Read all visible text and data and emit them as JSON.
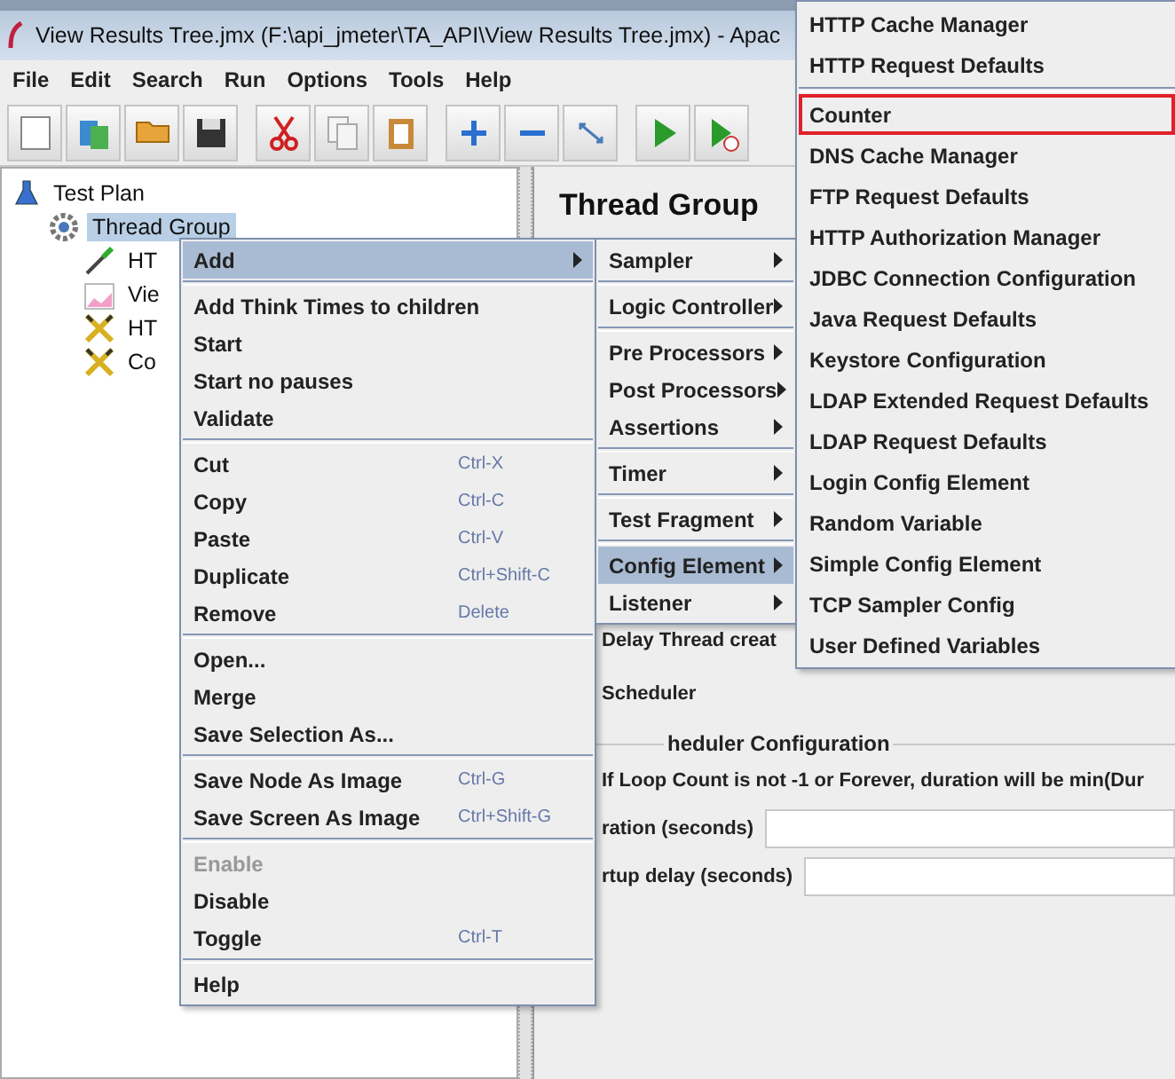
{
  "title_bar": {
    "title": "View Results Tree.jmx (F:\\api_jmeter\\TA_API\\View Results Tree.jmx) - Apac"
  },
  "menu_bar": [
    "File",
    "Edit",
    "Search",
    "Run",
    "Options",
    "Tools",
    "Help"
  ],
  "tree": [
    {
      "label": "Test Plan",
      "kind": "plan",
      "selected": false,
      "children": [
        {
          "label": "Thread Group",
          "kind": "threads",
          "selected": true,
          "children": [
            {
              "label": "HT",
              "kind": "sampler",
              "selected": false
            },
            {
              "label": "Vie",
              "kind": "listener",
              "selected": false
            },
            {
              "label": "HT",
              "kind": "config",
              "selected": false
            },
            {
              "label": "Co",
              "kind": "config",
              "selected": false
            }
          ]
        }
      ]
    }
  ],
  "thread_group_panel": {
    "title": "Thread Group",
    "delay_option": "Delay Thread creat",
    "scheduler_option": "Scheduler",
    "scheduler_section": "heduler Configuration",
    "scheduler_note": "If Loop Count is not -1 or Forever, duration will be min(Dur",
    "fields": [
      {
        "label": "ration (seconds)"
      },
      {
        "label": "rtup delay (seconds)"
      }
    ]
  },
  "context_menu": [
    [
      {
        "label": "Add",
        "submenu": true,
        "selected": true,
        "disabled": false
      }
    ],
    [
      {
        "label": "Add Think Times to children",
        "submenu": false,
        "selected": false,
        "disabled": false
      },
      {
        "label": "Start",
        "submenu": false,
        "selected": false,
        "disabled": false
      },
      {
        "label": "Start no pauses",
        "submenu": false,
        "selected": false,
        "disabled": false
      },
      {
        "label": "Validate",
        "submenu": false,
        "selected": false,
        "disabled": false
      }
    ],
    [
      {
        "label": "Cut",
        "shortcut": "Ctrl-X",
        "submenu": false,
        "selected": false,
        "disabled": false
      },
      {
        "label": "Copy",
        "shortcut": "Ctrl-C",
        "submenu": false,
        "selected": false,
        "disabled": false
      },
      {
        "label": "Paste",
        "shortcut": "Ctrl-V",
        "submenu": false,
        "selected": false,
        "disabled": false
      },
      {
        "label": "Duplicate",
        "shortcut": "Ctrl+Shift-C",
        "submenu": false,
        "selected": false,
        "disabled": false
      },
      {
        "label": "Remove",
        "shortcut": "Delete",
        "submenu": false,
        "selected": false,
        "disabled": false
      }
    ],
    [
      {
        "label": "Open...",
        "submenu": false,
        "selected": false,
        "disabled": false
      },
      {
        "label": "Merge",
        "submenu": false,
        "selected": false,
        "disabled": false
      },
      {
        "label": "Save Selection As...",
        "submenu": false,
        "selected": false,
        "disabled": false
      }
    ],
    [
      {
        "label": "Save Node As Image",
        "shortcut": "Ctrl-G",
        "submenu": false,
        "selected": false,
        "disabled": false
      },
      {
        "label": "Save Screen As Image",
        "shortcut": "Ctrl+Shift-G",
        "submenu": false,
        "selected": false,
        "disabled": false
      }
    ],
    [
      {
        "label": "Enable",
        "submenu": false,
        "selected": false,
        "disabled": true
      },
      {
        "label": "Disable",
        "submenu": false,
        "selected": false,
        "disabled": false
      },
      {
        "label": "Toggle",
        "shortcut": "Ctrl-T",
        "submenu": false,
        "selected": false,
        "disabled": false
      }
    ],
    [
      {
        "label": "Help",
        "submenu": false,
        "selected": false,
        "disabled": false
      }
    ]
  ],
  "add_submenu": [
    [
      {
        "label": "Sampler",
        "selected": false
      }
    ],
    [
      {
        "label": "Logic Controller",
        "selected": false
      }
    ],
    [
      {
        "label": "Pre Processors",
        "selected": false
      },
      {
        "label": "Post Processors",
        "selected": false
      },
      {
        "label": "Assertions",
        "selected": false
      }
    ],
    [
      {
        "label": "Timer",
        "selected": false
      }
    ],
    [
      {
        "label": "Test Fragment",
        "selected": false
      }
    ],
    [
      {
        "label": "Config Element",
        "selected": true
      },
      {
        "label": "Listener",
        "selected": false
      }
    ]
  ],
  "config_submenu": [
    [
      {
        "label": "HTTP Cache Manager",
        "outlined": false
      },
      {
        "label": "HTTP Request Defaults",
        "outlined": false
      }
    ],
    [
      {
        "label": "Counter",
        "outlined": true
      },
      {
        "label": "DNS Cache Manager",
        "outlined": false
      },
      {
        "label": "FTP Request Defaults",
        "outlined": false
      },
      {
        "label": "HTTP Authorization Manager",
        "outlined": false
      },
      {
        "label": "JDBC Connection Configuration",
        "outlined": false
      },
      {
        "label": "Java Request Defaults",
        "outlined": false
      },
      {
        "label": "Keystore Configuration",
        "outlined": false
      },
      {
        "label": "LDAP Extended Request Defaults",
        "outlined": false
      },
      {
        "label": "LDAP Request Defaults",
        "outlined": false
      },
      {
        "label": "Login Config Element",
        "outlined": false
      },
      {
        "label": "Random Variable",
        "outlined": false
      },
      {
        "label": "Simple Config Element",
        "outlined": false
      },
      {
        "label": "TCP Sampler Config",
        "outlined": false
      },
      {
        "label": "User Defined Variables",
        "outlined": false
      }
    ]
  ]
}
